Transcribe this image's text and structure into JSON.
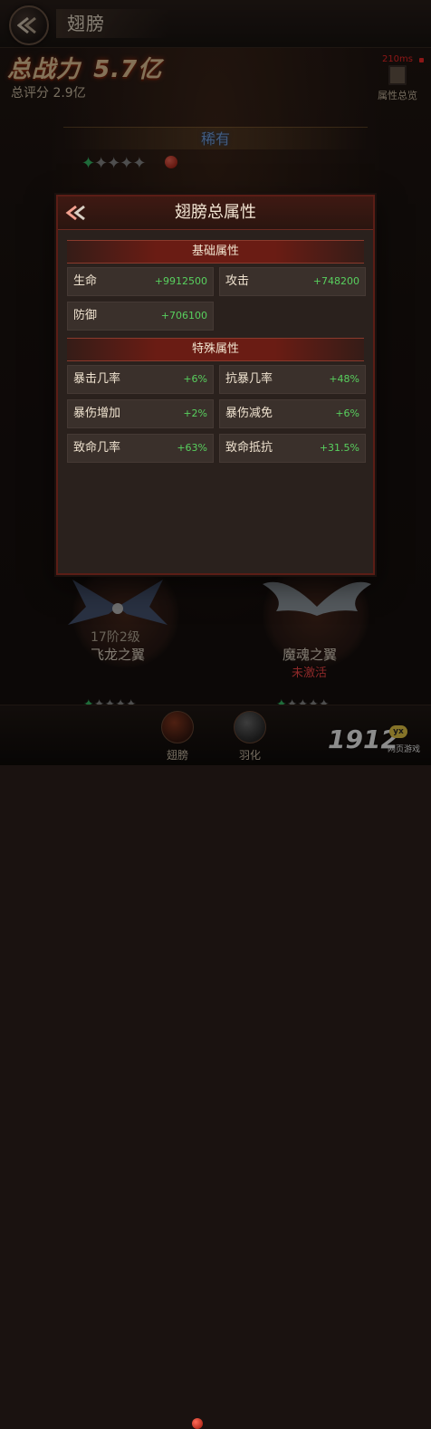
{
  "header": {
    "title": "翅膀"
  },
  "stats": {
    "power_label": "总战力",
    "power_value": "5.7亿",
    "score_label": "总评分",
    "score_value": "2.9亿",
    "ping": "210ms",
    "attr_overview_label": "属性总览"
  },
  "rarity": {
    "label": "稀有"
  },
  "modal": {
    "title": "翅膀总属性",
    "sections": [
      {
        "title": "基础属性",
        "items": [
          {
            "label": "生命",
            "value": "+9912500"
          },
          {
            "label": "攻击",
            "value": "+748200"
          },
          {
            "label": "防御",
            "value": "+706100"
          }
        ]
      },
      {
        "title": "特殊属性",
        "items": [
          {
            "label": "暴击几率",
            "value": "+6%"
          },
          {
            "label": "抗暴几率",
            "value": "+48%"
          },
          {
            "label": "暴伤增加",
            "value": "+2%"
          },
          {
            "label": "暴伤减免",
            "value": "+6%"
          },
          {
            "label": "致命几率",
            "value": "+63%"
          },
          {
            "label": "致命抵抗",
            "value": "+31.5%"
          }
        ]
      }
    ]
  },
  "wings": [
    {
      "level": "17阶2级",
      "name": "飞龙之翼"
    },
    {
      "name": "魔魂之翼",
      "status": "未激活"
    }
  ],
  "bottom_nav": {
    "items": [
      {
        "label": "翅膀",
        "icon": "wing-icon"
      },
      {
        "label": "羽化",
        "icon": "feather-icon"
      }
    ]
  },
  "watermark": {
    "brand": "1912",
    "badge": "yx",
    "sub": "网页游戏"
  },
  "colors": {
    "accent_red": "#6a1c14",
    "value_green": "#58d05e",
    "rarity_blue": "#77a7e8",
    "status_red": "#ff4a4a"
  }
}
